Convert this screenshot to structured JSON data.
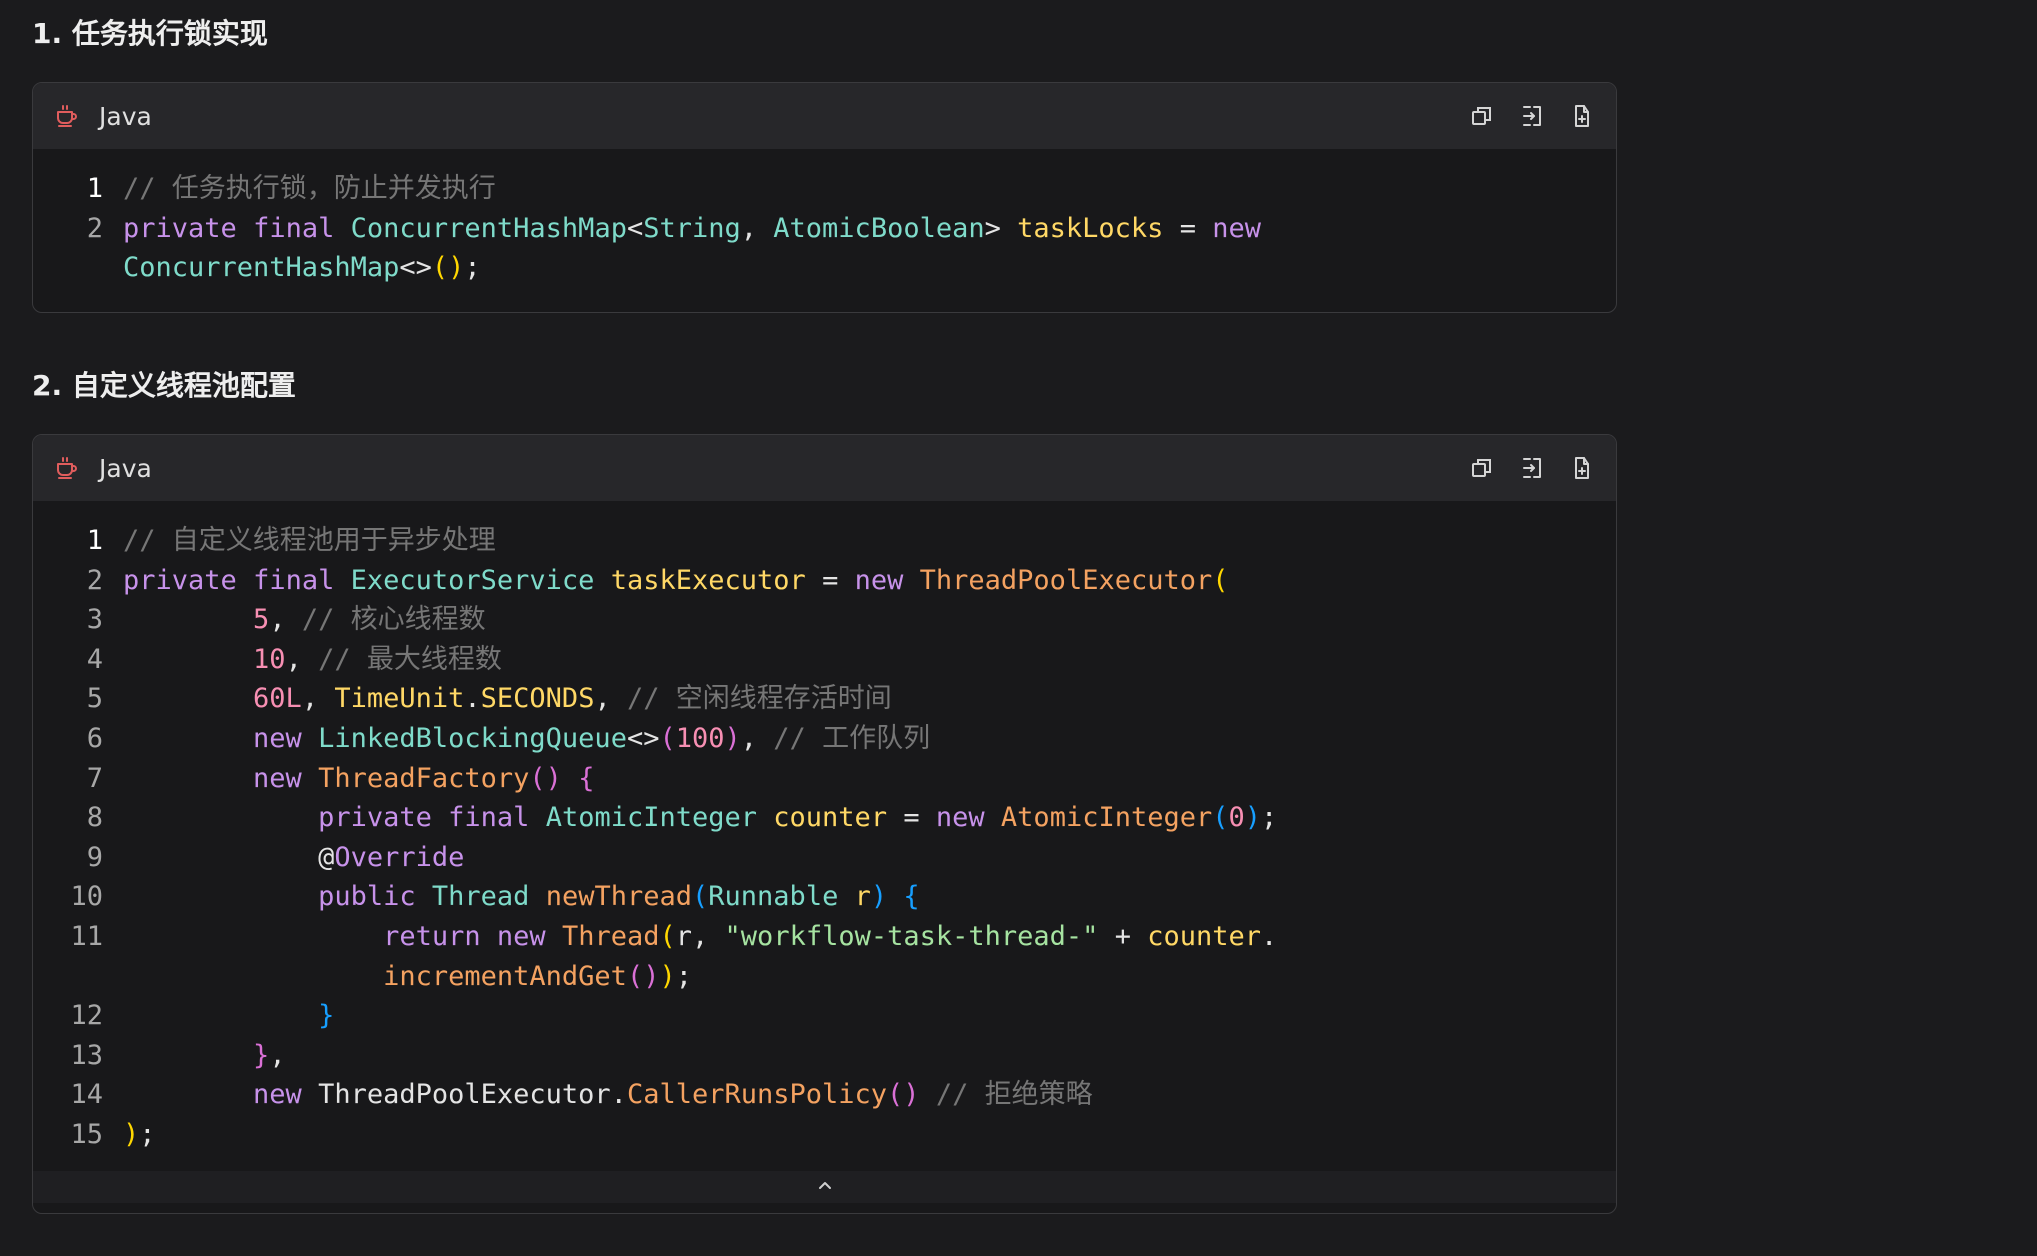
{
  "sections": [
    {
      "title": "1. 任务执行锁实现",
      "language": "Java",
      "lines": [
        {
          "num": "1",
          "tokens": [
            [
              "cm",
              "// 任务执行锁，防止并发执行"
            ]
          ]
        },
        {
          "num": "2",
          "tokens": [
            [
              "kw",
              "private"
            ],
            [
              "src",
              " "
            ],
            [
              "kw",
              "final"
            ],
            [
              "src",
              " "
            ],
            [
              "ty",
              "ConcurrentHashMap"
            ],
            [
              "pn",
              "<"
            ],
            [
              "ty",
              "String"
            ],
            [
              "pn",
              ", "
            ],
            [
              "ty",
              "AtomicBoolean"
            ],
            [
              "pn",
              ">"
            ],
            [
              "src",
              " "
            ],
            [
              "vr",
              "taskLocks"
            ],
            [
              "src",
              " "
            ],
            [
              "op",
              "="
            ],
            [
              "src",
              " "
            ],
            [
              "kw",
              "new"
            ]
          ]
        },
        {
          "num": "",
          "tokens": [
            [
              "ty",
              "ConcurrentHashMap"
            ],
            [
              "pn",
              "<>"
            ],
            [
              "p1",
              "()"
            ],
            [
              "pn",
              ";"
            ]
          ]
        }
      ]
    },
    {
      "title": "2. 自定义线程池配置",
      "language": "Java",
      "lines": [
        {
          "num": "1",
          "tokens": [
            [
              "cm",
              "// 自定义线程池用于异步处理"
            ]
          ]
        },
        {
          "num": "2",
          "tokens": [
            [
              "kw",
              "private"
            ],
            [
              "src",
              " "
            ],
            [
              "kw",
              "final"
            ],
            [
              "src",
              " "
            ],
            [
              "ty",
              "ExecutorService"
            ],
            [
              "src",
              " "
            ],
            [
              "vr",
              "taskExecutor"
            ],
            [
              "src",
              " "
            ],
            [
              "op",
              "="
            ],
            [
              "src",
              " "
            ],
            [
              "kw",
              "new"
            ],
            [
              "src",
              " "
            ],
            [
              "fn",
              "ThreadPoolExecutor"
            ],
            [
              "p1",
              "("
            ]
          ]
        },
        {
          "num": "3",
          "tokens": [
            [
              "src",
              "        "
            ],
            [
              "nu",
              "5"
            ],
            [
              "pn",
              ", "
            ],
            [
              "cm",
              "// 核心线程数"
            ]
          ]
        },
        {
          "num": "4",
          "tokens": [
            [
              "src",
              "        "
            ],
            [
              "nu",
              "10"
            ],
            [
              "pn",
              ", "
            ],
            [
              "cm",
              "// 最大线程数"
            ]
          ]
        },
        {
          "num": "5",
          "tokens": [
            [
              "src",
              "        "
            ],
            [
              "nu",
              "60L"
            ],
            [
              "pn",
              ", "
            ],
            [
              "vr",
              "TimeUnit"
            ],
            [
              "pn",
              "."
            ],
            [
              "vr",
              "SECONDS"
            ],
            [
              "pn",
              ", "
            ],
            [
              "cm",
              "// 空闲线程存活时间"
            ]
          ]
        },
        {
          "num": "6",
          "tokens": [
            [
              "src",
              "        "
            ],
            [
              "kw",
              "new"
            ],
            [
              "src",
              " "
            ],
            [
              "ty",
              "LinkedBlockingQueue"
            ],
            [
              "pn",
              "<>"
            ],
            [
              "p2",
              "("
            ],
            [
              "nu",
              "100"
            ],
            [
              "p2",
              ")"
            ],
            [
              "pn",
              ", "
            ],
            [
              "cm",
              "// 工作队列"
            ]
          ]
        },
        {
          "num": "7",
          "tokens": [
            [
              "src",
              "        "
            ],
            [
              "kw",
              "new"
            ],
            [
              "src",
              " "
            ],
            [
              "fn",
              "ThreadFactory"
            ],
            [
              "p2",
              "()"
            ],
            [
              "src",
              " "
            ],
            [
              "p2",
              "{"
            ]
          ]
        },
        {
          "num": "8",
          "tokens": [
            [
              "src",
              "            "
            ],
            [
              "kw",
              "private"
            ],
            [
              "src",
              " "
            ],
            [
              "kw",
              "final"
            ],
            [
              "src",
              " "
            ],
            [
              "ty",
              "AtomicInteger"
            ],
            [
              "src",
              " "
            ],
            [
              "vr",
              "counter"
            ],
            [
              "src",
              " "
            ],
            [
              "op",
              "="
            ],
            [
              "src",
              " "
            ],
            [
              "kw",
              "new"
            ],
            [
              "src",
              " "
            ],
            [
              "fn",
              "AtomicInteger"
            ],
            [
              "p3",
              "("
            ],
            [
              "nu",
              "0"
            ],
            [
              "p3",
              ")"
            ],
            [
              "pn",
              ";"
            ]
          ]
        },
        {
          "num": "9",
          "tokens": [
            [
              "src",
              "            "
            ],
            [
              "an",
              "@"
            ],
            [
              "kw",
              "Override"
            ]
          ]
        },
        {
          "num": "10",
          "tokens": [
            [
              "src",
              "            "
            ],
            [
              "kw",
              "public"
            ],
            [
              "src",
              " "
            ],
            [
              "ty",
              "Thread"
            ],
            [
              "src",
              " "
            ],
            [
              "fn",
              "newThread"
            ],
            [
              "p3",
              "("
            ],
            [
              "ty",
              "Runnable"
            ],
            [
              "src",
              " "
            ],
            [
              "vr",
              "r"
            ],
            [
              "p3",
              ")"
            ],
            [
              "src",
              " "
            ],
            [
              "p3",
              "{"
            ]
          ]
        },
        {
          "num": "11",
          "tokens": [
            [
              "src",
              "                "
            ],
            [
              "kw",
              "return"
            ],
            [
              "src",
              " "
            ],
            [
              "kw",
              "new"
            ],
            [
              "src",
              " "
            ],
            [
              "fn",
              "Thread"
            ],
            [
              "p1",
              "("
            ],
            [
              "src",
              "r, "
            ],
            [
              "st",
              "\"workflow-task-thread-\""
            ],
            [
              "src",
              " "
            ],
            [
              "op",
              "+"
            ],
            [
              "src",
              " "
            ],
            [
              "vr",
              "counter"
            ],
            [
              "pn",
              "."
            ]
          ]
        },
        {
          "num": "",
          "tokens": [
            [
              "src",
              "                "
            ],
            [
              "fn",
              "incrementAndGet"
            ],
            [
              "p2",
              "()"
            ],
            [
              "p1",
              ")"
            ],
            [
              "pn",
              ";"
            ]
          ]
        },
        {
          "num": "12",
          "tokens": [
            [
              "src",
              "            "
            ],
            [
              "p3",
              "}"
            ]
          ]
        },
        {
          "num": "13",
          "tokens": [
            [
              "src",
              "        "
            ],
            [
              "p2",
              "}"
            ],
            [
              "pn",
              ","
            ]
          ]
        },
        {
          "num": "14",
          "tokens": [
            [
              "src",
              "        "
            ],
            [
              "kw",
              "new"
            ],
            [
              "src",
              " ThreadPoolExecutor."
            ],
            [
              "fn",
              "CallerRunsPolicy"
            ],
            [
              "p2",
              "()"
            ],
            [
              "src",
              " "
            ],
            [
              "cm",
              "// 拒绝策略"
            ]
          ]
        },
        {
          "num": "15",
          "tokens": [
            [
              "p1",
              ")"
            ],
            [
              "pn",
              ";"
            ]
          ]
        }
      ]
    }
  ],
  "icons": {
    "language": "coffee-cup-icon",
    "copy": "copy-icon",
    "insert": "insert-icon",
    "new_file": "new-file-icon",
    "collapse": "chevron-up-icon"
  },
  "colors": {
    "background": "#1b1b1d",
    "code_header": "#27272a",
    "lang_icon": "#e05d5d"
  }
}
